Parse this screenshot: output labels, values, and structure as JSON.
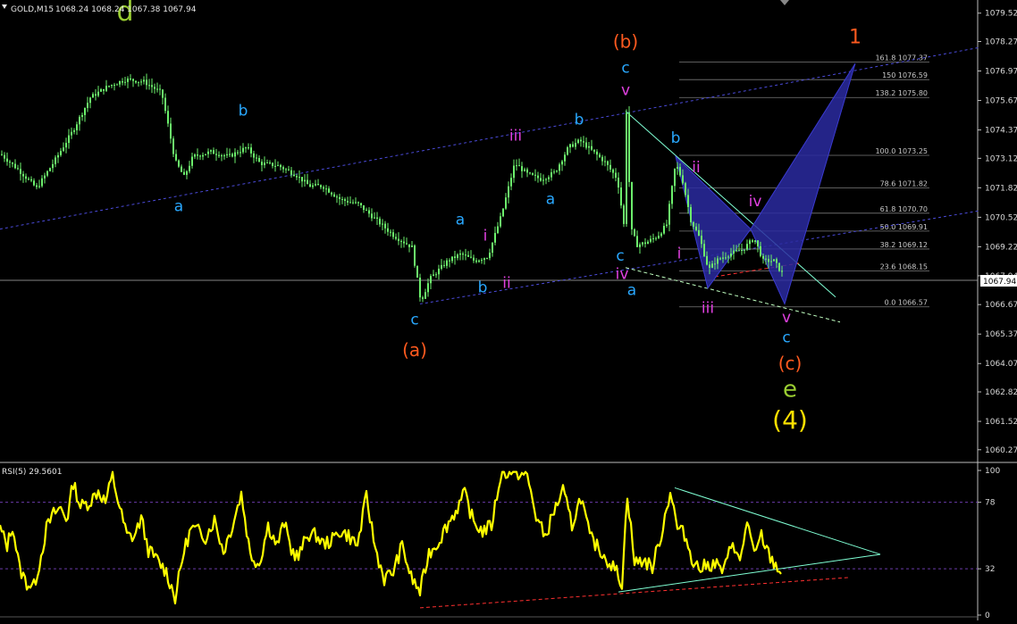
{
  "header": {
    "symbol_label": "GOLD,M15",
    "ohlc_label": "1068.24 1068.24 1067.38 1067.94"
  },
  "rsi_header": "RSI(5) 29.5601",
  "current_price_label": "1067.94",
  "colors": {
    "background": "#000000",
    "candles": "#6cf06c",
    "rsi_line": "#ffff00",
    "channel": "#4a4ad8",
    "triangle_fill": "#2a2aa0",
    "label_blue": "#29a8ff",
    "label_magenta": "#e040e0",
    "label_orange": "#ff5a1f",
    "label_green": "#9acd32",
    "label_yellow": "#ffe000"
  },
  "chart_data": [
    {
      "type": "candlestick",
      "title": "GOLD,M15",
      "y_axis_ticks": [
        "1079.52",
        "1078.27",
        "1076.97",
        "1075.67",
        "1074.37",
        "1073.12",
        "1071.82",
        "1070.52",
        "1069.22",
        "1067.94",
        "1066.67",
        "1065.37",
        "1064.07",
        "1062.82",
        "1061.52",
        "1060.27"
      ],
      "ylim": [
        1060.0,
        1080.0
      ],
      "current_price": 1067.94,
      "close_path": [
        [
          0,
          1073.3
        ],
        [
          20,
          1072.6
        ],
        [
          40,
          1071.8
        ],
        [
          60,
          1073.0
        ],
        [
          80,
          1074.3
        ],
        [
          100,
          1075.8
        ],
        [
          120,
          1076.3
        ],
        [
          140,
          1076.6
        ],
        [
          160,
          1076.5
        ],
        [
          180,
          1076.0
        ],
        [
          195,
          1073.0
        ],
        [
          205,
          1072.3
        ],
        [
          215,
          1073.2
        ],
        [
          235,
          1073.4
        ],
        [
          255,
          1073.2
        ],
        [
          275,
          1073.6
        ],
        [
          290,
          1072.9
        ],
        [
          310,
          1072.8
        ],
        [
          330,
          1072.4
        ],
        [
          345,
          1071.9
        ],
        [
          360,
          1071.9
        ],
        [
          380,
          1071.3
        ],
        [
          400,
          1071.1
        ],
        [
          420,
          1070.4
        ],
        [
          440,
          1069.7
        ],
        [
          460,
          1069.2
        ],
        [
          470,
          1066.8
        ],
        [
          480,
          1067.8
        ],
        [
          500,
          1068.6
        ],
        [
          515,
          1068.9
        ],
        [
          530,
          1068.6
        ],
        [
          545,
          1068.8
        ],
        [
          560,
          1070.6
        ],
        [
          575,
          1072.9
        ],
        [
          590,
          1072.4
        ],
        [
          605,
          1072.2
        ],
        [
          620,
          1072.5
        ],
        [
          635,
          1073.6
        ],
        [
          648,
          1073.9
        ],
        [
          660,
          1073.5
        ],
        [
          675,
          1073.0
        ],
        [
          690,
          1072.2
        ],
        [
          697,
          1070.2
        ],
        [
          700,
          1075.2
        ],
        [
          705,
          1070.0
        ],
        [
          712,
          1069.3
        ],
        [
          722,
          1069.4
        ],
        [
          735,
          1069.7
        ],
        [
          745,
          1070.2
        ],
        [
          755,
          1072.9
        ],
        [
          763,
          1072.1
        ],
        [
          772,
          1070.4
        ],
        [
          782,
          1069.6
        ],
        [
          792,
          1068.2
        ],
        [
          800,
          1068.6
        ],
        [
          815,
          1068.9
        ],
        [
          830,
          1069.1
        ],
        [
          843,
          1069.6
        ],
        [
          853,
          1068.6
        ],
        [
          865,
          1068.6
        ],
        [
          875,
          1068.0
        ]
      ],
      "wave_labels": [
        {
          "text": "d",
          "x": 140,
          "y": 1079.2,
          "color": "#9acd32",
          "size": 30
        },
        {
          "text": "b",
          "x": 272,
          "y": 1075.0,
          "color": "#29a8ff",
          "size": 17
        },
        {
          "text": "a",
          "x": 200,
          "y": 1070.8,
          "color": "#29a8ff",
          "size": 17
        },
        {
          "text": "a",
          "x": 515,
          "y": 1070.2,
          "color": "#29a8ff",
          "size": 17
        },
        {
          "text": "i",
          "x": 543,
          "y": 1069.5,
          "color": "#e040e0",
          "size": 17
        },
        {
          "text": "b",
          "x": 540,
          "y": 1067.2,
          "color": "#29a8ff",
          "size": 17
        },
        {
          "text": "ii",
          "x": 567,
          "y": 1067.4,
          "color": "#e040e0",
          "size": 17
        },
        {
          "text": "c",
          "x": 464,
          "y": 1065.8,
          "color": "#29a8ff",
          "size": 17
        },
        {
          "text": "(a)",
          "x": 464,
          "y": 1064.4,
          "color": "#ff5a1f",
          "size": 20
        },
        {
          "text": "iii",
          "x": 577,
          "y": 1073.9,
          "color": "#e040e0",
          "size": 17
        },
        {
          "text": "a",
          "x": 616,
          "y": 1071.1,
          "color": "#29a8ff",
          "size": 17
        },
        {
          "text": "b",
          "x": 648,
          "y": 1074.6,
          "color": "#29a8ff",
          "size": 17
        },
        {
          "text": "(b)",
          "x": 700,
          "y": 1078.0,
          "color": "#ff5a1f",
          "size": 20
        },
        {
          "text": "c",
          "x": 700,
          "y": 1076.9,
          "color": "#29a8ff",
          "size": 17
        },
        {
          "text": "v",
          "x": 700,
          "y": 1075.9,
          "color": "#e040e0",
          "size": 17
        },
        {
          "text": "c",
          "x": 694,
          "y": 1068.6,
          "color": "#29a8ff",
          "size": 17
        },
        {
          "text": "iv",
          "x": 696,
          "y": 1067.8,
          "color": "#e040e0",
          "size": 17
        },
        {
          "text": "a",
          "x": 707,
          "y": 1067.1,
          "color": "#29a8ff",
          "size": 17
        },
        {
          "text": "b",
          "x": 756,
          "y": 1073.8,
          "color": "#29a8ff",
          "size": 17
        },
        {
          "text": "ii",
          "x": 779,
          "y": 1072.5,
          "color": "#e040e0",
          "size": 17
        },
        {
          "text": "i",
          "x": 760,
          "y": 1068.7,
          "color": "#e040e0",
          "size": 17
        },
        {
          "text": "iii",
          "x": 792,
          "y": 1066.3,
          "color": "#e040e0",
          "size": 17
        },
        {
          "text": "iv",
          "x": 845,
          "y": 1071.0,
          "color": "#e040e0",
          "size": 17
        },
        {
          "text": "v",
          "x": 880,
          "y": 1065.9,
          "color": "#e040e0",
          "size": 17
        },
        {
          "text": "c",
          "x": 880,
          "y": 1065.0,
          "color": "#29a8ff",
          "size": 17
        },
        {
          "text": "(c)",
          "x": 884,
          "y": 1063.8,
          "color": "#ff5a1f",
          "size": 20
        },
        {
          "text": "e",
          "x": 884,
          "y": 1062.6,
          "color": "#9acd32",
          "size": 26
        },
        {
          "text": "(4)",
          "x": 884,
          "y": 1061.2,
          "color": "#ffe000",
          "size": 28
        },
        {
          "text": "1",
          "x": 957,
          "y": 1078.2,
          "color": "#ff5a1f",
          "size": 22
        }
      ],
      "fibonacci_levels": [
        {
          "ratio": "161.8",
          "price": 1077.37,
          "label": "161.8 1077.37"
        },
        {
          "ratio": "150",
          "price": 1076.59,
          "label": "150 1076.59"
        },
        {
          "ratio": "138.2",
          "price": 1075.8,
          "label": "138.2 1075.80"
        },
        {
          "ratio": "100.0",
          "price": 1073.25,
          "label": "100.0 1073.25"
        },
        {
          "ratio": "78.6",
          "price": 1071.82,
          "label": "78.6 1071.82"
        },
        {
          "ratio": "61.8",
          "price": 1070.7,
          "label": "61.8 1070.70"
        },
        {
          "ratio": "50.0",
          "price": 1069.91,
          "label": "50.0 1069.91"
        },
        {
          "ratio": "38.2",
          "price": 1069.12,
          "label": "38.2 1069.12"
        },
        {
          "ratio": "23.6",
          "price": 1068.15,
          "label": "23.6 1068.15"
        },
        {
          "ratio": "0.0",
          "price": 1066.57,
          "label": "0.0 1066.57"
        }
      ],
      "trend_lines": [
        {
          "kind": "dotted",
          "color": "#4a4ad8",
          "points": [
            [
              0,
              1070.0
            ],
            [
              1095,
              1078.0
            ]
          ]
        },
        {
          "kind": "dotted",
          "color": "#4a4ad8",
          "points": [
            [
              470,
              1066.7
            ],
            [
              1095,
              1070.8
            ]
          ]
        },
        {
          "kind": "solid",
          "color": "#7fffd4",
          "points": [
            [
              700,
              1075.2
            ],
            [
              935,
              1067.0
            ]
          ]
        },
        {
          "kind": "dashed",
          "color": "#c0ffc0",
          "points": [
            [
              700,
              1068.3
            ],
            [
              940,
              1065.9
            ]
          ]
        },
        {
          "kind": "dashed",
          "color": "#ff3030",
          "points": [
            [
              800,
              1067.9
            ],
            [
              895,
              1068.5
            ]
          ]
        }
      ],
      "pattern_polygon": [
        [
          756,
          1073.2
        ],
        [
          792,
          1067.4
        ],
        [
          840,
          1070.0
        ],
        [
          878,
          1066.7
        ],
        [
          957,
          1077.3
        ],
        [
          840,
          1070.0
        ],
        [
          756,
          1073.2
        ]
      ]
    },
    {
      "type": "line",
      "title": "RSI(5) 29.5601",
      "y_axis_ticks": [
        "100",
        "78",
        "32",
        "0"
      ],
      "ylim": [
        0,
        100
      ],
      "levels": [
        78,
        32
      ],
      "series": [
        {
          "values": [
            [
              0,
              60
            ],
            [
              8,
              48
            ],
            [
              14,
              62
            ],
            [
              22,
              32
            ],
            [
              30,
              22
            ],
            [
              38,
              20
            ],
            [
              45,
              38
            ],
            [
              52,
              60
            ],
            [
              60,
              70
            ],
            [
              68,
              74
            ],
            [
              75,
              66
            ],
            [
              82,
              92
            ],
            [
              90,
              75
            ],
            [
              100,
              78
            ],
            [
              110,
              86
            ],
            [
              118,
              78
            ],
            [
              126,
              96
            ],
            [
              134,
              74
            ],
            [
              142,
              55
            ],
            [
              150,
              54
            ],
            [
              158,
              67
            ],
            [
              166,
              45
            ],
            [
              176,
              38
            ],
            [
              186,
              30
            ],
            [
              196,
              12
            ],
            [
              206,
              45
            ],
            [
              214,
              60
            ],
            [
              222,
              58
            ],
            [
              230,
              54
            ],
            [
              240,
              66
            ],
            [
              250,
              44
            ],
            [
              260,
              62
            ],
            [
              270,
              84
            ],
            [
              280,
              42
            ],
            [
              290,
              35
            ],
            [
              300,
              62
            ],
            [
              310,
              48
            ],
            [
              318,
              64
            ],
            [
              326,
              45
            ],
            [
              334,
              40
            ],
            [
              344,
              56
            ],
            [
              354,
              55
            ],
            [
              362,
              49
            ],
            [
              372,
              52
            ],
            [
              380,
              58
            ],
            [
              390,
              55
            ],
            [
              400,
              48
            ],
            [
              410,
              82
            ],
            [
              420,
              46
            ],
            [
              430,
              25
            ],
            [
              440,
              30
            ],
            [
              450,
              48
            ],
            [
              460,
              26
            ],
            [
              470,
              16
            ],
            [
              480,
              43
            ],
            [
              490,
              50
            ],
            [
              500,
              62
            ],
            [
              510,
              72
            ],
            [
              520,
              84
            ],
            [
              530,
              64
            ],
            [
              540,
              58
            ],
            [
              550,
              62
            ],
            [
              560,
              96
            ],
            [
              570,
              100
            ],
            [
              580,
              98
            ],
            [
              590,
              96
            ],
            [
              600,
              68
            ],
            [
              610,
              54
            ],
            [
              620,
              72
            ],
            [
              630,
              86
            ],
            [
              640,
              62
            ],
            [
              650,
              82
            ],
            [
              660,
              54
            ],
            [
              670,
              46
            ],
            [
              680,
              38
            ],
            [
              690,
              30
            ],
            [
              696,
              22
            ],
            [
              702,
              84
            ],
            [
              710,
              36
            ],
            [
              720,
              38
            ],
            [
              730,
              33
            ],
            [
              740,
              56
            ],
            [
              750,
              86
            ],
            [
              758,
              60
            ],
            [
              766,
              56
            ],
            [
              774,
              40
            ],
            [
              782,
              32
            ],
            [
              790,
              34
            ],
            [
              800,
              36
            ],
            [
              810,
              30
            ],
            [
              820,
              52
            ],
            [
              828,
              35
            ],
            [
              836,
              66
            ],
            [
              844,
              40
            ],
            [
              852,
              55
            ],
            [
              860,
              42
            ],
            [
              866,
              36
            ],
            [
              874,
              30
            ]
          ]
        }
      ],
      "trend_lines": [
        {
          "kind": "solid",
          "color": "#7fffd4",
          "points": [
            [
              755,
              88
            ],
            [
              985,
              42
            ]
          ]
        },
        {
          "kind": "solid",
          "color": "#7fffd4",
          "points": [
            [
              692,
              16
            ],
            [
              985,
              42
            ]
          ]
        },
        {
          "kind": "dashed",
          "color": "#ff3030",
          "points": [
            [
              470,
              5
            ],
            [
              950,
              26
            ]
          ]
        }
      ]
    }
  ]
}
